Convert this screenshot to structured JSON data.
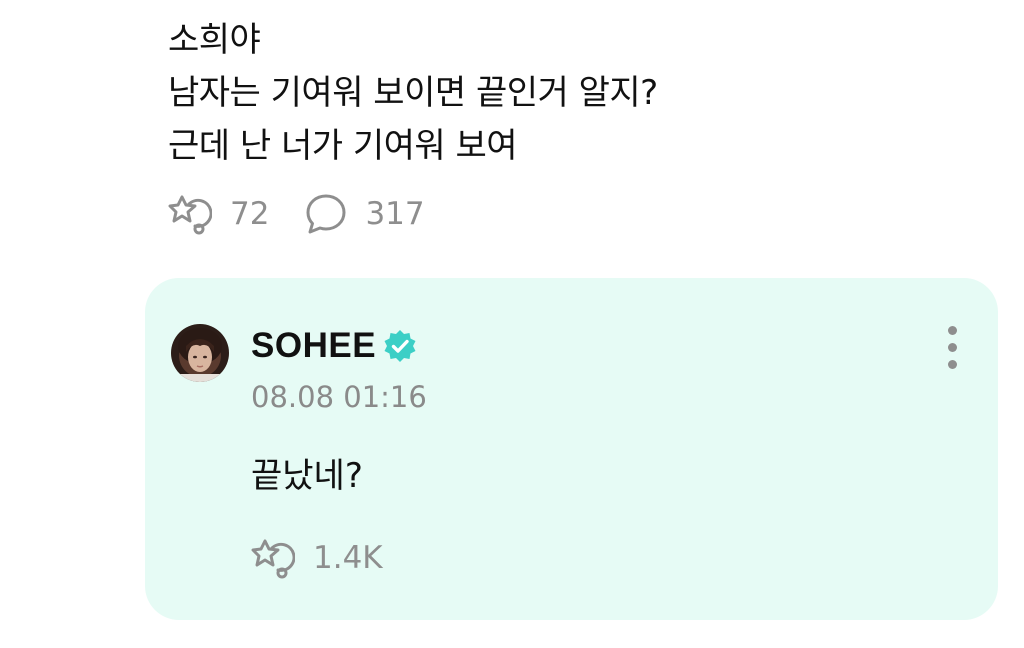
{
  "post": {
    "lines": [
      "소희야",
      "남자는 기여워 보이면 끝인거 알지?",
      "근데 난 너가 기여워 보여"
    ],
    "reaction_icon": "reaction-sparkle-icon",
    "reaction_count": "72",
    "comment_icon": "comment-bubble-icon",
    "comment_count": "317"
  },
  "reply": {
    "author": "SOHEE",
    "verified_icon": "verified-badge-icon",
    "timestamp": "08.08 01:16",
    "text": "끝났네?",
    "reaction_icon": "reaction-sparkle-icon",
    "reaction_count": "1.4K",
    "more_icon": "more-vertical-icon"
  },
  "colors": {
    "card_background": "#e6fbf5",
    "verified": "#3ccfc6",
    "muted": "#8e8e8e",
    "text": "#111111"
  }
}
